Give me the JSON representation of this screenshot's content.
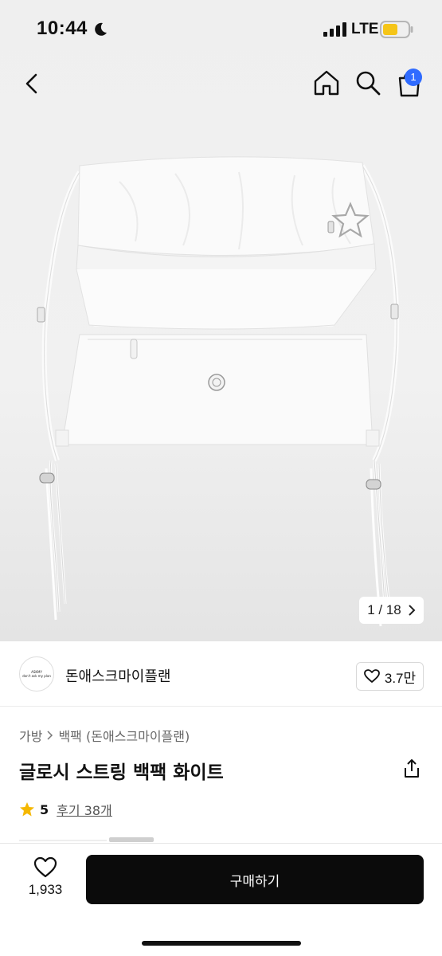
{
  "status_bar": {
    "time": "10:44",
    "network": "LTE",
    "battery_color": "#f5c518"
  },
  "header": {
    "icons": [
      "back-icon",
      "home-icon",
      "search-icon",
      "cart-icon"
    ],
    "cart_badge": "1",
    "badge_color": "#2f6bff"
  },
  "gallery": {
    "counter": "1 / 18"
  },
  "shop": {
    "name": "돈애스크마이플랜",
    "logo_lines": [
      "ASKMY",
      "don't ask my plan"
    ],
    "likes": "3.7만"
  },
  "product": {
    "breadcrumb": [
      "가방",
      "백팩 (돈애스크마이플랜)"
    ],
    "title": "글로시 스트링 백팩 화이트",
    "rating": "5",
    "reviews": "후기 38개",
    "star_color": "#f5b800"
  },
  "bottom_bar": {
    "wish_count": "1,933",
    "buy_label": "구매하기"
  }
}
